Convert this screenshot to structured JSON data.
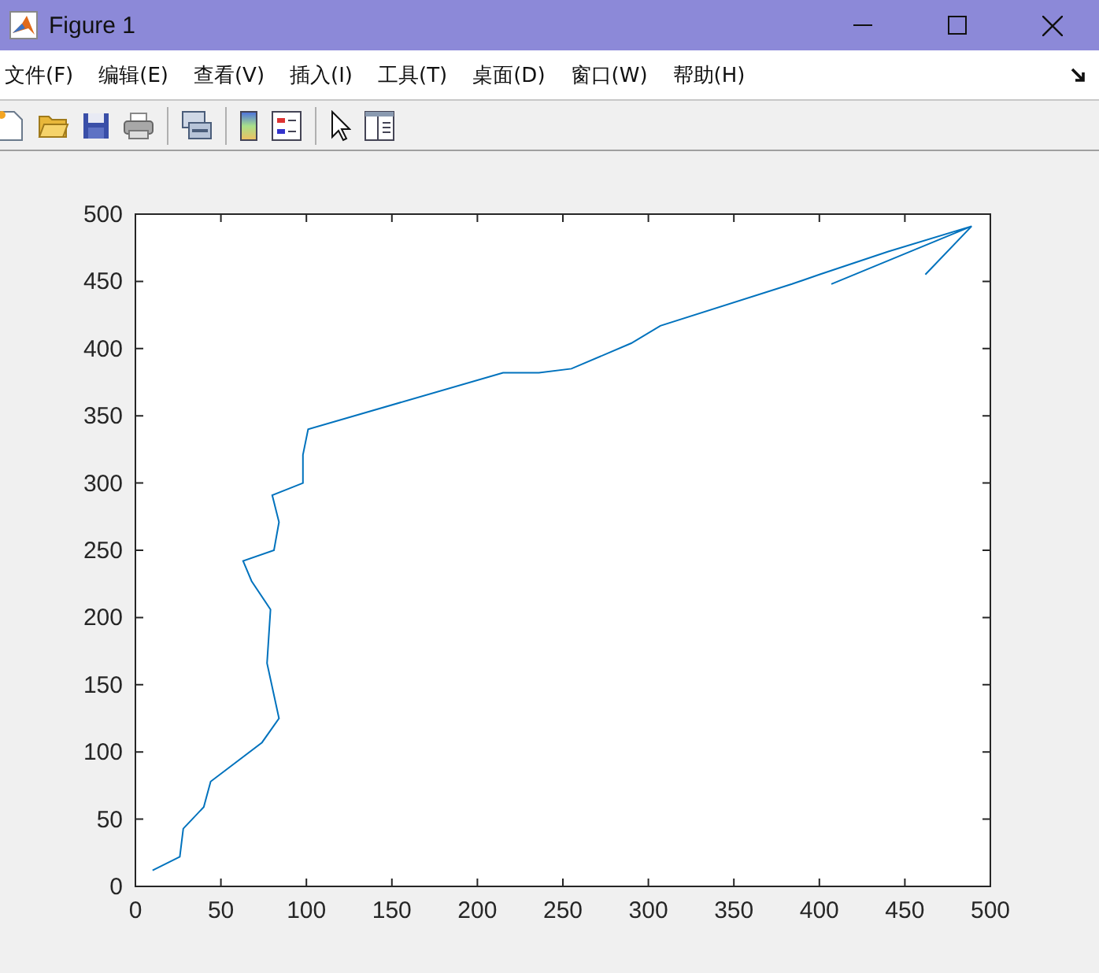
{
  "window": {
    "title": "Figure 1"
  },
  "menu": [
    {
      "label": "文件(F)"
    },
    {
      "label": "编辑(E)"
    },
    {
      "label": "查看(V)"
    },
    {
      "label": "插入(I)"
    },
    {
      "label": "工具(T)"
    },
    {
      "label": "桌面(D)"
    },
    {
      "label": "窗口(W)"
    },
    {
      "label": "帮助(H)"
    }
  ],
  "figure": {
    "chart_data": {
      "type": "line",
      "xlim": [
        0,
        500
      ],
      "ylim": [
        0,
        500
      ],
      "xticks": [
        0,
        50,
        100,
        150,
        200,
        250,
        300,
        350,
        400,
        450,
        500
      ],
      "yticks": [
        0,
        50,
        100,
        150,
        200,
        250,
        300,
        350,
        400,
        450,
        500
      ],
      "x": [
        10,
        26,
        28,
        40,
        44,
        74,
        84,
        77,
        79,
        68,
        63,
        81,
        84,
        80,
        98,
        98,
        101,
        215,
        236,
        255,
        290,
        307,
        384,
        400,
        440,
        489,
        407,
        489,
        462
      ],
      "series": [
        {
          "color": "#0072bd",
          "values": [
            12,
            22,
            43,
            59,
            78,
            107,
            125,
            166,
            206,
            227,
            242,
            250,
            271,
            291,
            300,
            321,
            340,
            382,
            382,
            385,
            404,
            417,
            448,
            455,
            472,
            491,
            448,
            491,
            455
          ]
        }
      ]
    }
  }
}
